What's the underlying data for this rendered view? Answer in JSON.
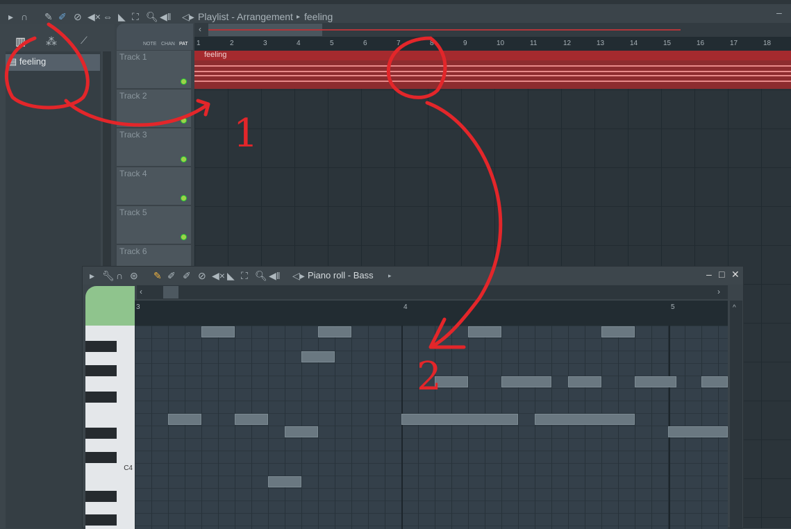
{
  "playlist": {
    "title": "Playlist - Arrangement",
    "pattern": "feeling",
    "toolbar_icons": [
      "play-arrow-icon",
      "magnet-icon",
      "pencil-icon",
      "paint-icon",
      "delete-icon",
      "mute-icon",
      "slip-icon",
      "slice-icon",
      "select-icon",
      "zoom-icon",
      "playback-icon",
      "speaker-icon"
    ],
    "picker_tabs": [
      "PAT",
      "audio",
      "automation"
    ],
    "picker_items": [
      {
        "label": "feeling"
      }
    ],
    "filter_labels": {
      "note": "NOTE",
      "chan": "CHAN",
      "pat": "PAT"
    },
    "bars": [
      "1",
      "2",
      "3",
      "4",
      "5",
      "6",
      "7",
      "8",
      "9",
      "10",
      "11",
      "12",
      "13",
      "14",
      "15",
      "16",
      "17",
      "18"
    ],
    "tracks": [
      "Track 1",
      "Track 2",
      "Track 3",
      "Track 4",
      "Track 5",
      "Track 6"
    ],
    "clip": {
      "label": "feeling",
      "track": 1,
      "color": "#a52a2e"
    }
  },
  "piano_roll": {
    "title": "Piano roll - Bass",
    "toolbar_icons": [
      "play-arrow-icon",
      "wrench-icon",
      "magnet-icon",
      "menu-icon",
      "pencil-icon",
      "paint-icon",
      "paint-add-icon",
      "delete-icon",
      "mute-icon",
      "slice-icon",
      "select-icon",
      "zoom-icon",
      "playback-icon",
      "speaker-icon"
    ],
    "bars": [
      "3",
      "4",
      "5"
    ],
    "key_label": "C4",
    "notes": [
      {
        "pitch": "B4",
        "start_step": 4,
        "len_steps": 2
      },
      {
        "pitch": "B4",
        "start_step": 11,
        "len_steps": 2
      },
      {
        "pitch": "B4",
        "start_step": 20,
        "len_steps": 2
      },
      {
        "pitch": "B4",
        "start_step": 28,
        "len_steps": 2
      },
      {
        "pitch": "A4",
        "start_step": 10,
        "len_steps": 2
      },
      {
        "pitch": "G4",
        "start_step": 18,
        "len_steps": 2
      },
      {
        "pitch": "G4",
        "start_step": 22,
        "len_steps": 3
      },
      {
        "pitch": "G4",
        "start_step": 26,
        "len_steps": 2
      },
      {
        "pitch": "G4",
        "start_step": 30,
        "len_steps": 2.5
      },
      {
        "pitch": "G4",
        "start_step": 34,
        "len_steps": 2
      },
      {
        "pitch": "E4",
        "start_step": 2,
        "len_steps": 2
      },
      {
        "pitch": "E4",
        "start_step": 6,
        "len_steps": 2
      },
      {
        "pitch": "E4",
        "start_step": 16,
        "len_steps": 7
      },
      {
        "pitch": "E4",
        "start_step": 24,
        "len_steps": 6
      },
      {
        "pitch": "D#4",
        "start_step": 9,
        "len_steps": 2
      },
      {
        "pitch": "D#4",
        "start_step": 32,
        "len_steps": 4
      },
      {
        "pitch": "B3",
        "start_step": 8,
        "len_steps": 2
      }
    ]
  },
  "annotations": {
    "one": "1",
    "two": "2",
    "color": "#e3262a"
  }
}
